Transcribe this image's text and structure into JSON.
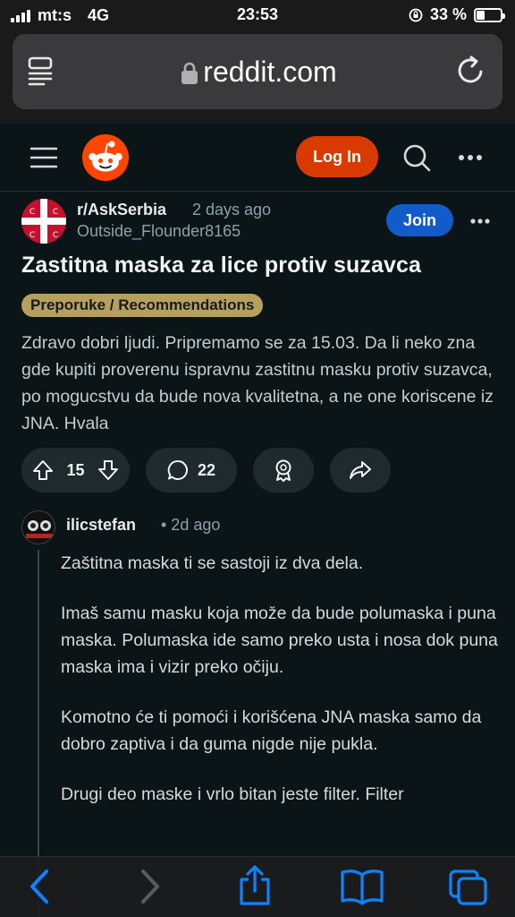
{
  "status_bar": {
    "carrier": "mt:s",
    "network": "4G",
    "time": "23:53",
    "battery": "33 %",
    "battery_level": 0.33
  },
  "browser": {
    "url": "reddit.com",
    "icons": [
      "reader-icon",
      "lock-icon",
      "reload-icon"
    ]
  },
  "reddit_header": {
    "login_label": "Log In",
    "icons": [
      "menu-icon",
      "reddit-logo",
      "search-icon",
      "more-icon"
    ],
    "colors": {
      "brand": "#ff4500",
      "login": "#d93a00"
    }
  },
  "post": {
    "subreddit": "r/AskSerbia",
    "age": "2 days ago",
    "author": "Outside_Flounder8165",
    "join_label": "Join",
    "title": "Zastitna maska za lice protiv suzavca",
    "flair": "Preporuke / Recommendations",
    "body": "Zdravo dobri ljudi. Pripremamo se za 15.03. Da li neko zna gde kupiti proverenu ispravnu zastitnu masku protiv suzavca, po mogucstvu da bude nova kvalitetna, a ne one koriscene iz JNA. Hvala",
    "votes": "15",
    "comments": "22",
    "colors": {
      "join": "#115bca",
      "flair": "#b5a05d"
    }
  },
  "comment": {
    "author": "ilicstefan",
    "age": "• 2d ago",
    "paragraphs": [
      "Zaštitna maska ti se sastoji iz dva dela.",
      "Imaš samu masku koja može da bude polumaska i puna maska. Polumaska ide samo preko usta i nosa dok puna maska ima i vizir preko očiju.",
      "Komotno će ti pomoći i korišćena JNA maska samo da dobro zaptiva i da guma nigde nije pukla.",
      "Drugi deo maske i vrlo bitan jeste filter. Filter"
    ]
  },
  "bottom_toolbar": {
    "icons": [
      "back-icon",
      "forward-icon",
      "share-icon",
      "bookmarks-icon",
      "tabs-icon"
    ]
  }
}
